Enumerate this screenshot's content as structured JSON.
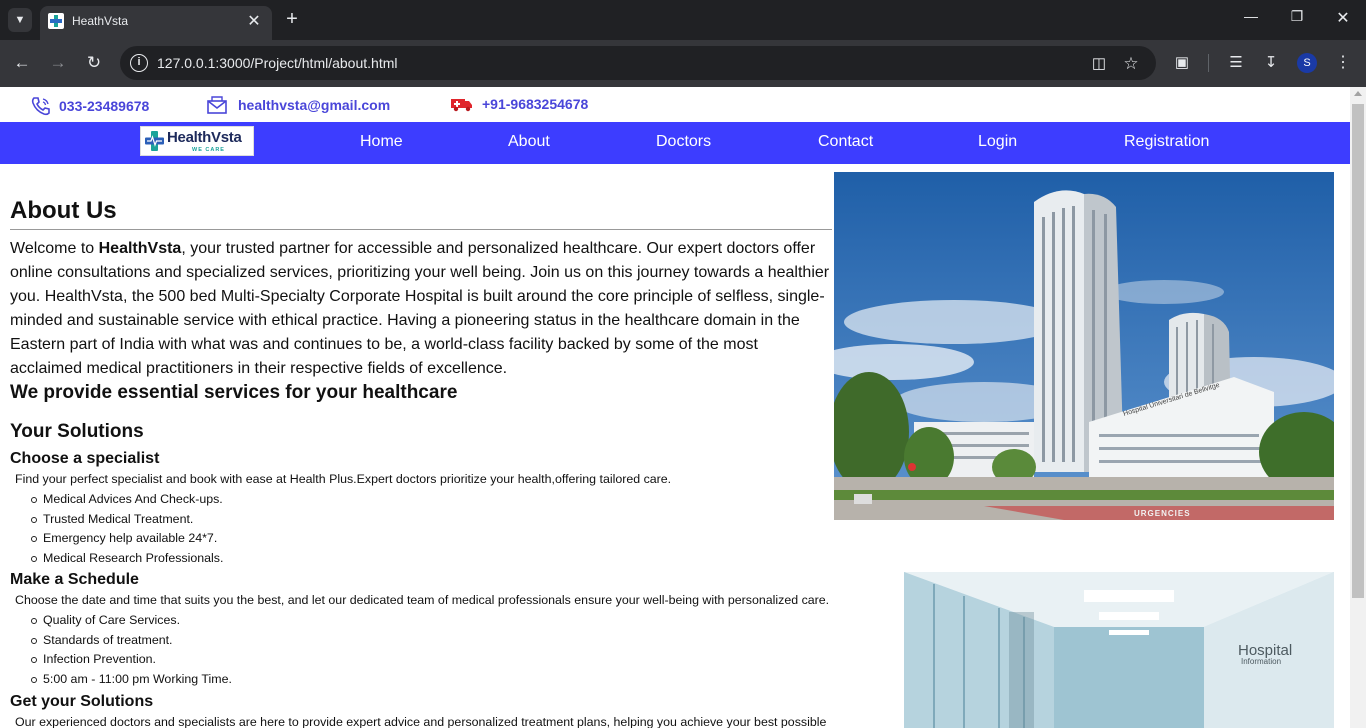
{
  "browser": {
    "tab_title": "HeathVsta",
    "url": "127.0.0.1:3000/Project/html/about.html",
    "profile_initial": "S"
  },
  "contact": {
    "phone": "033-23489678",
    "email": "healthvsta@gmail.com",
    "emergency": "+91-9683254678"
  },
  "logo": {
    "name": "HealthVsta",
    "tagline": "WE CARE"
  },
  "nav": {
    "home": "Home",
    "about": "About",
    "doctors": "Doctors",
    "contact": "Contact",
    "login": "Login",
    "registration": "Registration"
  },
  "about": {
    "title": "About Us",
    "intro_before": "Welcome to ",
    "intro_brand": "HealthVsta",
    "intro_after": ", your trusted partner for accessible and personalized healthcare. Our expert doctors offer online consultations and specialized services, prioritizing your well being. Join us on this journey towards a healthier you. HealthVsta, the 500 bed Multi-Specialty Corporate Hospital is built around the core principle of selfless, single-minded and sustainable service with ethical practice. Having a pioneering status in the healthcare domain in the Eastern part of India with what was and continues to be, a world-class facility backed by some of the most acclaimed medical practitioners in their respective fields of excellence.",
    "services_heading": "We provide essential services for your healthcare",
    "solutions_heading": "Your Solutions"
  },
  "solutions": [
    {
      "title": "Choose a specialist",
      "desc": "Find your perfect specialist and book with ease at Health Plus.Expert doctors prioritize your health,offering tailored care.",
      "items": [
        "Medical Advices And Check-ups.",
        "Trusted Medical Treatment.",
        "Emergency help available 24*7.",
        "Medical Research Professionals."
      ]
    },
    {
      "title": "Make a Schedule",
      "desc": "Choose the date and time that suits you the best, and let our dedicated team of medical professionals ensure your well-being with personalized care.",
      "items": [
        "Quality of Care Services.",
        "Standards of treatment.",
        "Infection Prevention.",
        "5:00 am - 11:00 pm Working Time."
      ]
    },
    {
      "title": "Get your Solutions",
      "desc": "Our experienced doctors and specialists are here to provide expert advice and personalized treatment plans, helping you achieve your best possible"
    }
  ],
  "images": {
    "building_sign": "Hospital Universitari de Bellvitge",
    "ground_sign": "URGENCIES",
    "corridor_sign_1": "Hospital",
    "corridor_sign_2": "Information"
  }
}
